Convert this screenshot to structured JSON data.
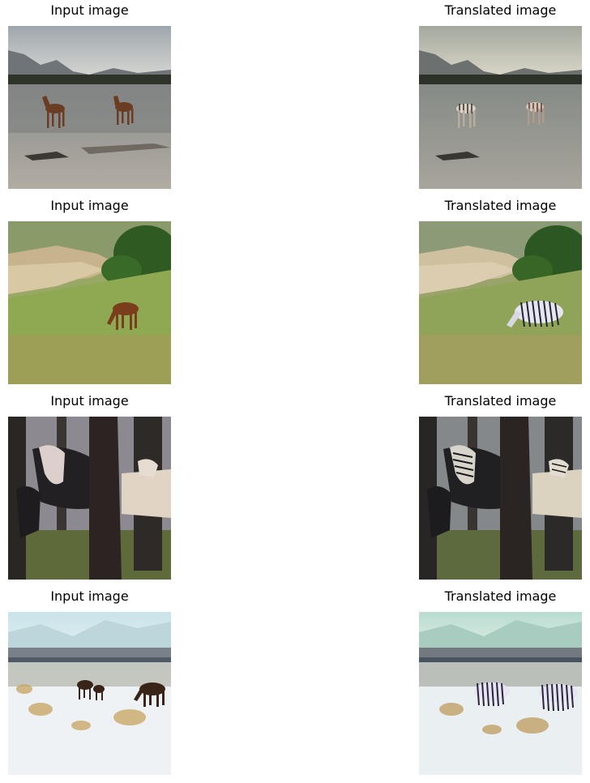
{
  "figure": {
    "rows": [
      {
        "input": {
          "title": "Input image",
          "scene": "two brown horses running on wet beach sand under a cloudy sky with mountains"
        },
        "output": {
          "title": "Translated image",
          "scene": "same beach scene with horses rendered with zebra-like stripes"
        }
      },
      {
        "input": {
          "title": "Input image",
          "scene": "brown horse grazing on a green grassy hillside with trees"
        },
        "output": {
          "title": "Translated image",
          "scene": "same hillside with the horse turned into a striped zebra"
        }
      },
      {
        "input": {
          "title": "Input image",
          "scene": "white and dark horses among dark tree trunks in a forest"
        },
        "output": {
          "title": "Translated image",
          "scene": "same forest scene with horse heads showing zebra stripes"
        }
      },
      {
        "input": {
          "title": "Input image",
          "scene": "horses grazing in a snowy field with dry grass and distant town"
        },
        "output": {
          "title": "Translated image",
          "scene": "same snowy field with horses rendered as zebras"
        }
      }
    ]
  }
}
